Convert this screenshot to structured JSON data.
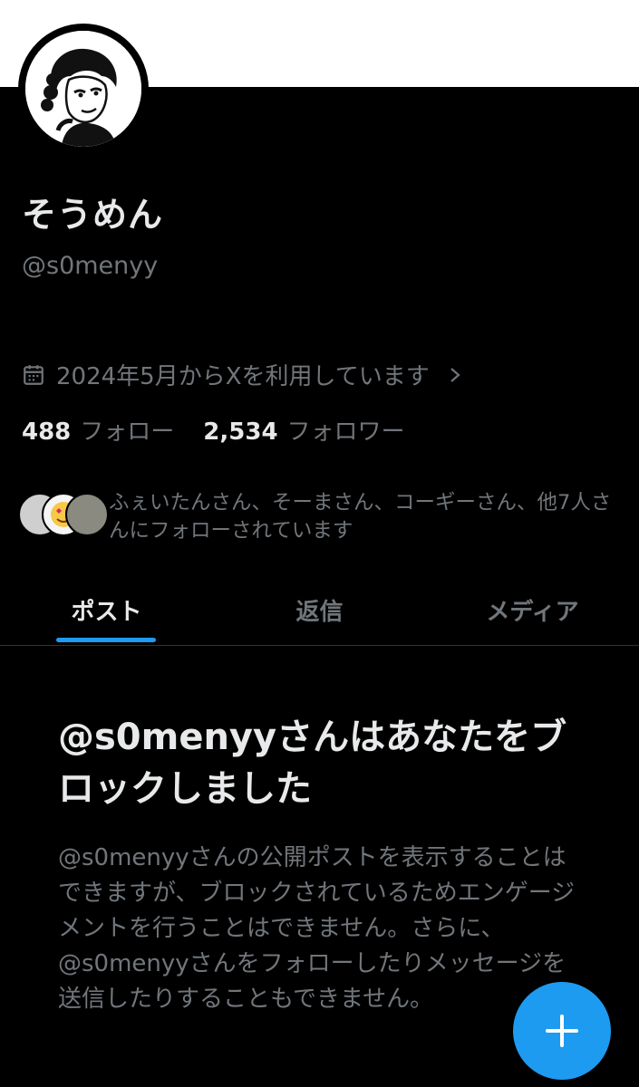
{
  "profile": {
    "display_name": "そうめん",
    "handle": "@s0menyy",
    "joined": "2024年5月からXを利用しています",
    "following_count": "488",
    "following_label": "フォロー",
    "followers_count": "2,534",
    "followers_label": "フォロワー",
    "known_followers": "ふぇいたんさん、そーまさん、コーギーさん、他7人さんにフォローされています"
  },
  "tabs": [
    {
      "label": "ポスト",
      "active": true
    },
    {
      "label": "返信",
      "active": false
    },
    {
      "label": "メディア",
      "active": false
    }
  ],
  "block_notice": {
    "title": "@s0menyyさんはあなたをブロックしました",
    "body": "@s0menyyさんの公開ポストを表示することはできますが、ブロックされているためエンゲージメントを行うことはできません。さらに、@s0menyyさんをフォローしたりメッセージを送信したりすることもできません。"
  },
  "colors": {
    "background": "#000000",
    "accent": "#1d9bf0",
    "text_primary": "#e7e9ea",
    "text_secondary": "#71767b"
  },
  "icons": {
    "calendar": "calendar-icon",
    "chevron": "chevron-right-icon",
    "compose": "plus-icon"
  }
}
